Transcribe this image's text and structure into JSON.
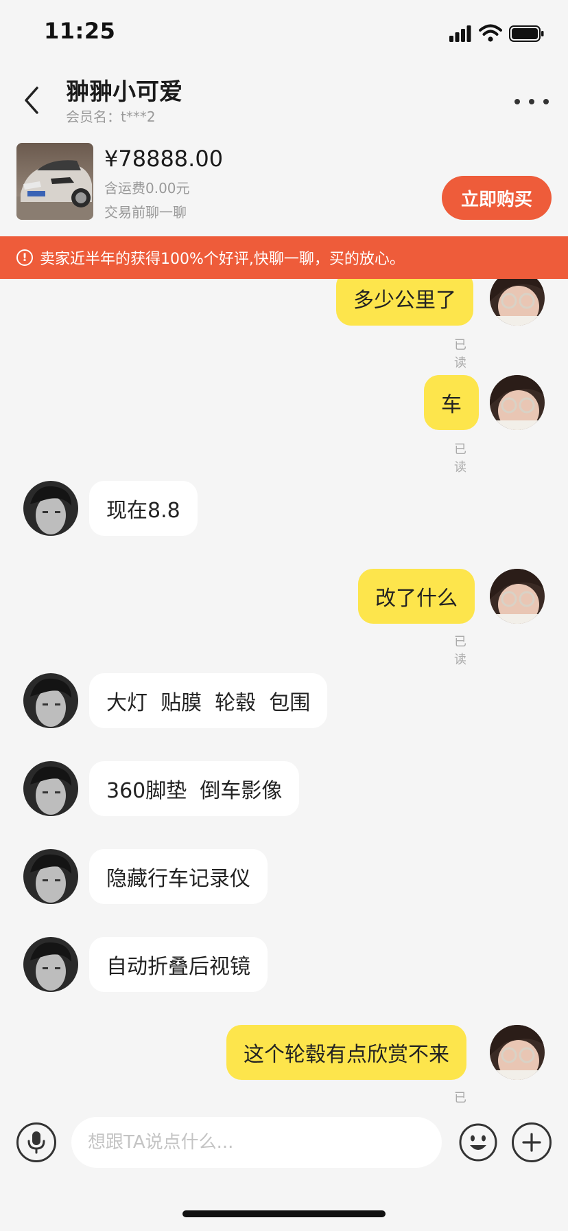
{
  "status_bar": {
    "time": "11:25"
  },
  "header": {
    "title": "翀翀小可爱",
    "subtitle": "会员名：t***2"
  },
  "product": {
    "price": "¥78888.00",
    "shipping": "含运费0.00元",
    "note": "交易前聊一聊",
    "buy_label": "立即购买"
  },
  "notice": {
    "text": "卖家近半年的获得100%个好评,快聊一聊，买的放心。"
  },
  "messages": [
    {
      "side": "me",
      "text": "多少公里了",
      "status": "已读"
    },
    {
      "side": "me",
      "text": "车",
      "status": "已读"
    },
    {
      "side": "them",
      "text": "现在8.8"
    },
    {
      "side": "me",
      "text": "改了什么",
      "status": "已读"
    },
    {
      "side": "them",
      "text": "大灯  贴膜  轮毂  包围"
    },
    {
      "side": "them",
      "text": "360脚垫  倒车影像"
    },
    {
      "side": "them",
      "text": "隐藏行车记录仪"
    },
    {
      "side": "them",
      "text": "自动折叠后视镜"
    },
    {
      "side": "me",
      "text": "这个轮毂有点欣赏不来",
      "status": "已读"
    }
  ],
  "input": {
    "placeholder": "想跟TA说点什么..."
  },
  "icons": {
    "back": "chevron-left-icon",
    "more": "more-dots-icon",
    "mic": "microphone-icon",
    "emoji": "emoji-icon",
    "plus": "plus-icon"
  },
  "colors": {
    "accent": "#ee5c3a",
    "my_bubble": "#fde54c",
    "their_bubble": "#ffffff",
    "background": "#f5f5f5"
  }
}
